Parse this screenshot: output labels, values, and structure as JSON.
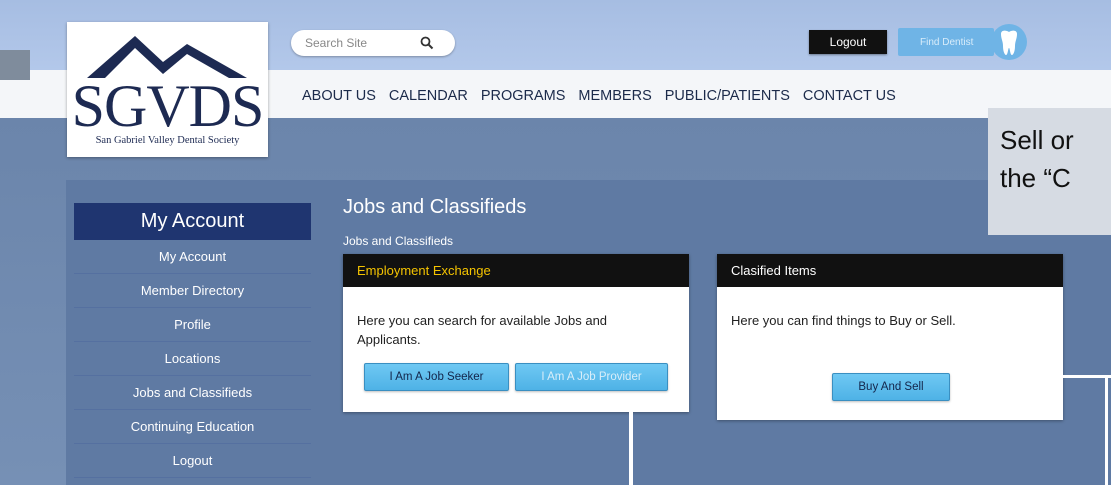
{
  "header": {
    "logo": {
      "letters": "SGVDS",
      "subtitle": "San Gabriel Valley Dental Society"
    },
    "search": {
      "placeholder": "Search Site",
      "value": ""
    },
    "logout_label": "Logout",
    "find_dentist_label": "Find Dentist",
    "nav": [
      "ABOUT US",
      "CALENDAR",
      "PROGRAMS",
      "MEMBERS",
      "PUBLIC/PATIENTS",
      "CONTACT US"
    ]
  },
  "main": {
    "heading": "Jobs and Classifieds",
    "breadcrumb": "Jobs and Classifieds"
  },
  "sidebar": {
    "title": "My Account",
    "items": [
      "My Account",
      "Member Directory",
      "Profile",
      "Locations",
      "Jobs and Classifieds",
      "Continuing Education",
      "Logout"
    ]
  },
  "cards": {
    "employment": {
      "title": "Employment Exchange",
      "body": "Here you can search for available Jobs and Applicants.",
      "seeker_label": "I Am A Job Seeker",
      "provider_label": "I Am A Job Provider"
    },
    "classified": {
      "title": "Clasified Items",
      "body": "Here you can find things to Buy or Sell.",
      "buy_sell_label": "Buy And Sell"
    }
  },
  "callout": {
    "line1": "Sell or",
    "line2": "the “C"
  },
  "colors": {
    "card_header_bg": "#111111",
    "card_header_text": "#f5c400",
    "sidebar_title_bg": "#1f3570",
    "button_blue": "#4eb2e6"
  },
  "icons": [
    "search-icon",
    "tooth-icon"
  ]
}
